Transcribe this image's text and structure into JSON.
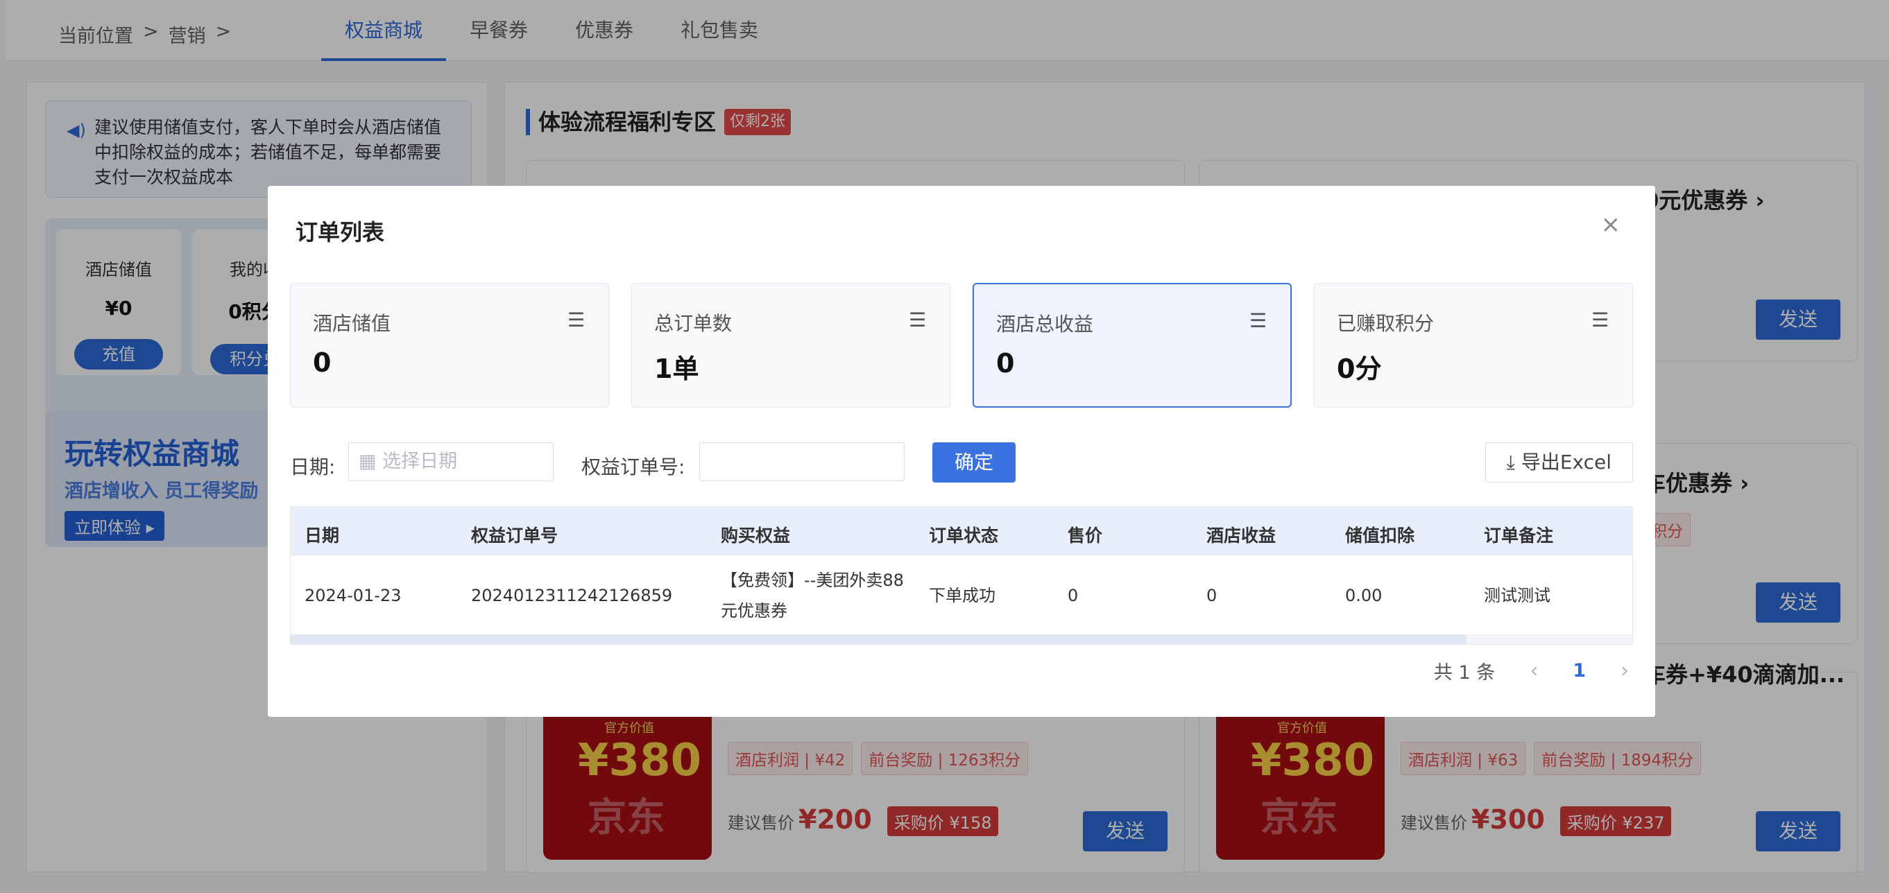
{
  "breadcrumb": {
    "prefix": "当前位置",
    "sep1": ">",
    "item": "营销",
    "sep2": ">"
  },
  "tabs": [
    {
      "label": "权益商城",
      "active": true
    },
    {
      "label": "早餐券",
      "active": false
    },
    {
      "label": "优惠券",
      "active": false
    },
    {
      "label": "礼包售卖",
      "active": false
    }
  ],
  "left": {
    "notice": "建议使用储值支付，客人下单时会从酒店储值中扣除权益的成本；若储值不足，每单都需要支付一次权益成本",
    "stat1": {
      "label": "酒店储值",
      "value": "¥0",
      "button": "充值"
    },
    "stat2": {
      "label": "我的收",
      "value": "0积分",
      "button": "积分兑"
    },
    "promo": {
      "title": "玩转权益商城",
      "subtitle": "酒店增收入 员工得奖励",
      "button": "立即体验"
    }
  },
  "right": {
    "section_title": "体验流程福利专区",
    "section_tag": "仅剩2张",
    "products": [
      {
        "title": "0元优惠券",
        "chips": [],
        "suggest_label": "",
        "suggest_price": "",
        "buy_label": "",
        "buy_price": "",
        "send": "发送"
      },
      {
        "title": "车优惠券",
        "chips": [
          "积分"
        ],
        "suggest_label": "",
        "suggest_price": "",
        "buy_label": "",
        "buy_price": "",
        "send": "发送"
      },
      {
        "title": "",
        "chips": [
          "酒店利润 | ¥42",
          "前台奖励 | 1263积分"
        ],
        "suggest_label": "建议售价",
        "suggest_price": "¥200",
        "buy_label": "采购价",
        "buy_price": "¥158",
        "send": "发送",
        "thumb": {
          "tag": "官方价值",
          "price": "¥380",
          "brand": "京东"
        }
      },
      {
        "title": "车券+¥40滴滴加...",
        "chips": [
          "酒店利润 | ¥63",
          "前台奖励 | 1894积分"
        ],
        "suggest_label": "建议售价",
        "suggest_price": "¥300",
        "buy_label": "采购价",
        "buy_price": "¥237",
        "send": "发送",
        "thumb": {
          "tag": "官方价值",
          "price": "¥380",
          "brand": "京东"
        }
      }
    ]
  },
  "modal": {
    "title": "订单列表",
    "close_icon": "×",
    "kpis": [
      {
        "label": "酒店储值",
        "value": "0"
      },
      {
        "label": "总订单数",
        "value": "1单"
      },
      {
        "label": "酒店总收益",
        "value": "0"
      },
      {
        "label": "已赚取积分",
        "value": "0分"
      }
    ],
    "filter": {
      "date_label": "日期:",
      "date_placeholder": "选择日期",
      "order_label": "权益订单号:",
      "order_value": "",
      "confirm": "确定",
      "export": "导出Excel"
    },
    "table": {
      "columns": [
        "日期",
        "权益订单号",
        "购买权益",
        "订单状态",
        "售价",
        "酒店收益",
        "储值扣除",
        "订单备注"
      ],
      "rows": [
        [
          "2024-01-23",
          "202401231124212685­9",
          "【免费领】--美团外卖88元优惠券",
          "下单成功",
          "0",
          "0",
          "0.00",
          "测试测试"
        ]
      ]
    },
    "pagination": {
      "total": "共 1 条",
      "current": "1",
      "prev": "‹",
      "next": "›"
    }
  },
  "colors": {
    "accent": "#2f6bd8",
    "danger": "#d63b3b"
  }
}
